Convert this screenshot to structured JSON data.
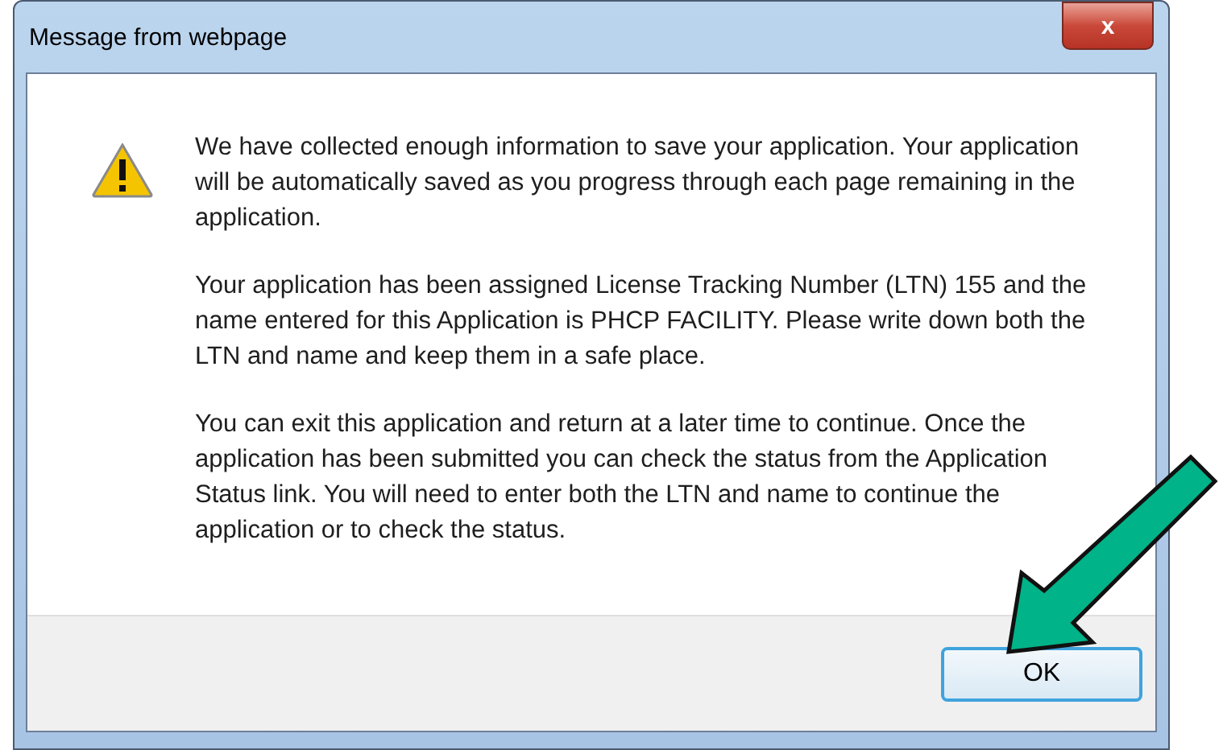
{
  "window": {
    "title": "Message from webpage",
    "close_label": "x"
  },
  "message": {
    "kind": "warning",
    "paragraphs": [
      "We have collected enough information to save your application.  Your application will be automatically saved as you progress through each page remaining in the application.",
      "Your application has been assigned License Tracking Number (LTN) 155 and the name entered for this Application is PHCP FACILITY.  Please write down both the LTN and name and keep them in a safe place.",
      "You can exit this application and return at a later time to continue. Once the application has been submitted you can check the status from the Application Status link.  You will need to enter both the LTN and name to continue the application or to check the status."
    ]
  },
  "buttons": [
    {
      "label": "OK",
      "selected": true
    }
  ],
  "annotation": {
    "kind": "arrow",
    "color": "#00b388"
  }
}
